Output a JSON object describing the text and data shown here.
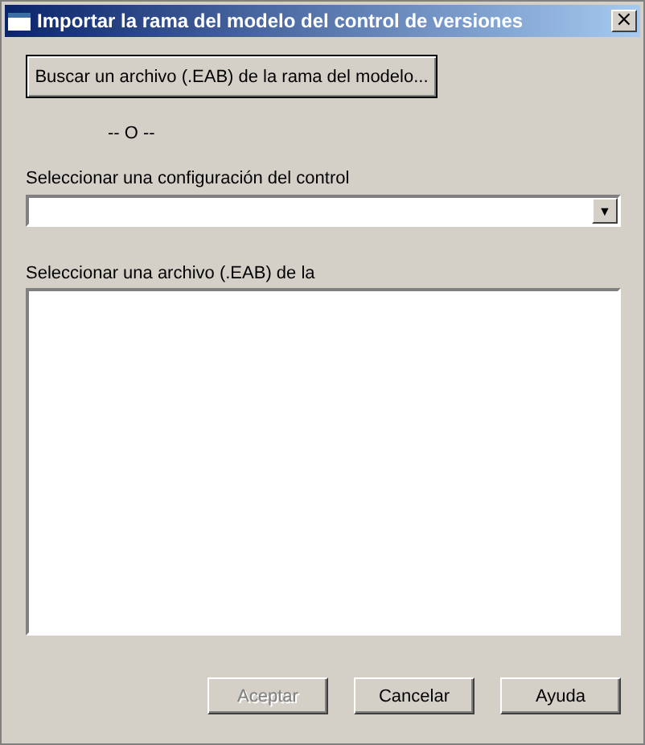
{
  "window": {
    "title": "Importar la rama del modelo del control de versiones",
    "close": "×"
  },
  "browse_button": {
    "label": "Buscar un archivo (.EAB) de la rama del modelo..."
  },
  "separator_text": "-- O --",
  "config_label": "Seleccionar una configuración del control",
  "config_combo": {
    "arrow": "▼"
  },
  "file_list_label": "Seleccionar una archivo (.EAB) de la",
  "buttons": [
    {
      "label": "Aceptar",
      "disabled": true
    },
    {
      "label": "Cancelar",
      "disabled": false
    },
    {
      "label": "Ayuda",
      "disabled": false
    }
  ]
}
